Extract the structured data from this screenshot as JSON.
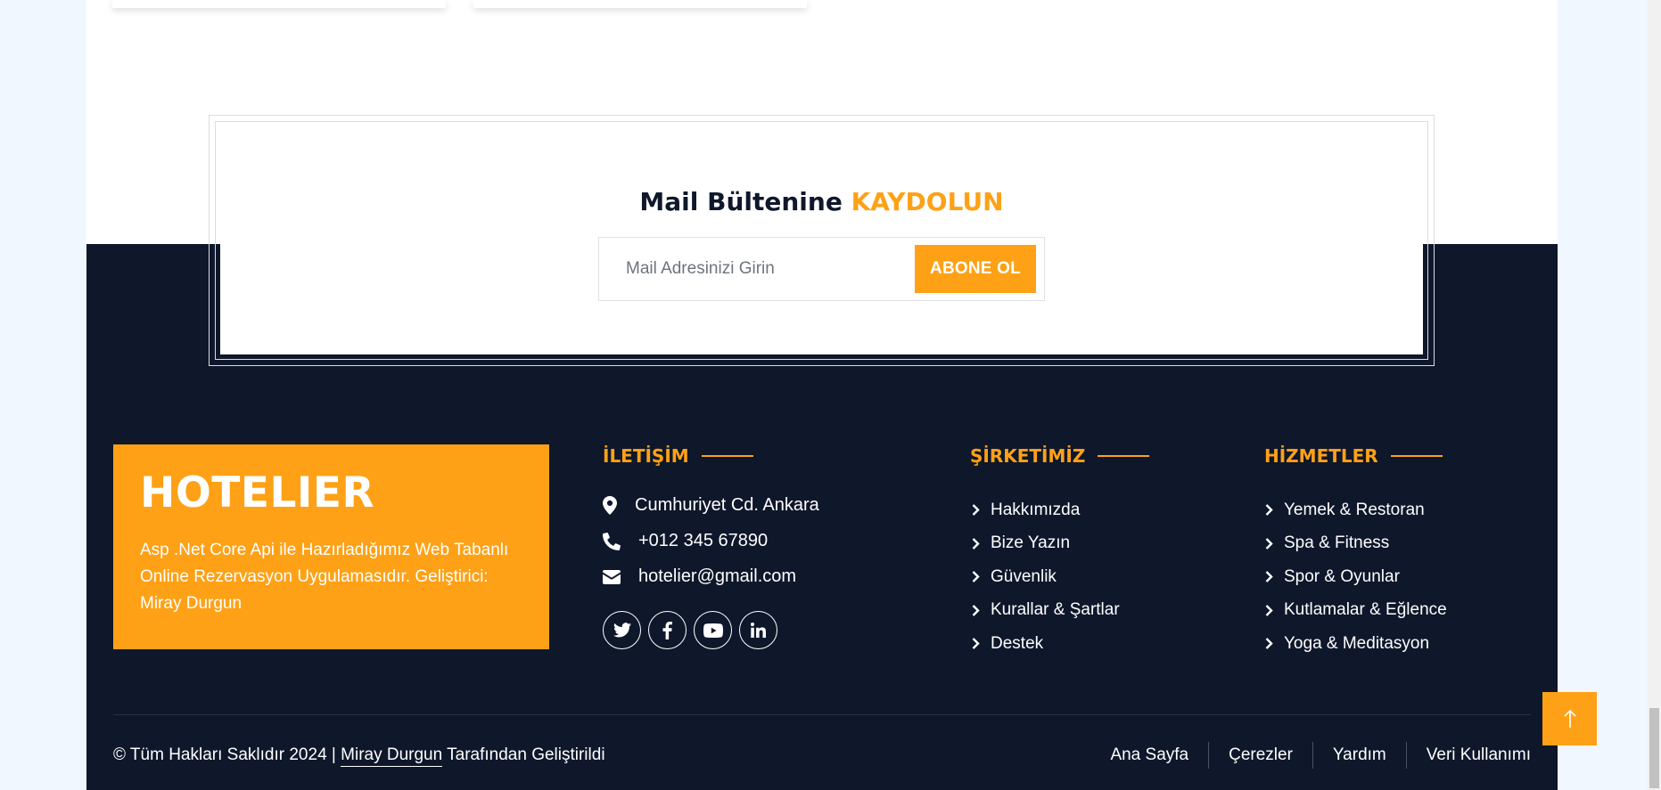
{
  "newsletter": {
    "title_main": "Mail Bültenine",
    "title_accent": "KAYDOLUN",
    "input_placeholder": "Mail Adresinizi Girin",
    "button_label": "ABONE OL"
  },
  "brand": {
    "name": "HOTELIER",
    "description": "Asp .Net Core Api ile Hazırladığımız Web Tabanlı Online Rezervasyon Uygulamasıdır. Geliştirici: Miray Durgun"
  },
  "contact": {
    "title": "İLETİŞİM",
    "address": "Cumhuriyet Cd. Ankara",
    "phone": "+012 345 67890",
    "email": "hotelier@gmail.com",
    "social_icons": [
      "twitter-icon",
      "facebook-icon",
      "youtube-icon",
      "linkedin-icon"
    ]
  },
  "company": {
    "title": "ŞİRKETİMİZ",
    "links": [
      "Hakkımızda",
      "Bize Yazın",
      "Güvenlik",
      "Kurallar & Şartlar",
      "Destek"
    ]
  },
  "services": {
    "title": "HİZMETLER",
    "links": [
      "Yemek & Restoran",
      "Spa & Fitness",
      "Spor & Oyunlar",
      "Kutlamalar & Eğlence",
      "Yoga & Meditasyon"
    ]
  },
  "copyright": {
    "prefix": "© Tüm Hakları Saklıdır 2024 |",
    "author": "Miray Durgun",
    "suffix": "Tarafından Geliştirildi"
  },
  "bottom_links": [
    "Ana Sayfa",
    "Çerezler",
    "Yardım",
    "Veri Kullanımı"
  ],
  "colors": {
    "accent": "#fea116",
    "dark": "#0f172b",
    "white": "#ffffff"
  }
}
